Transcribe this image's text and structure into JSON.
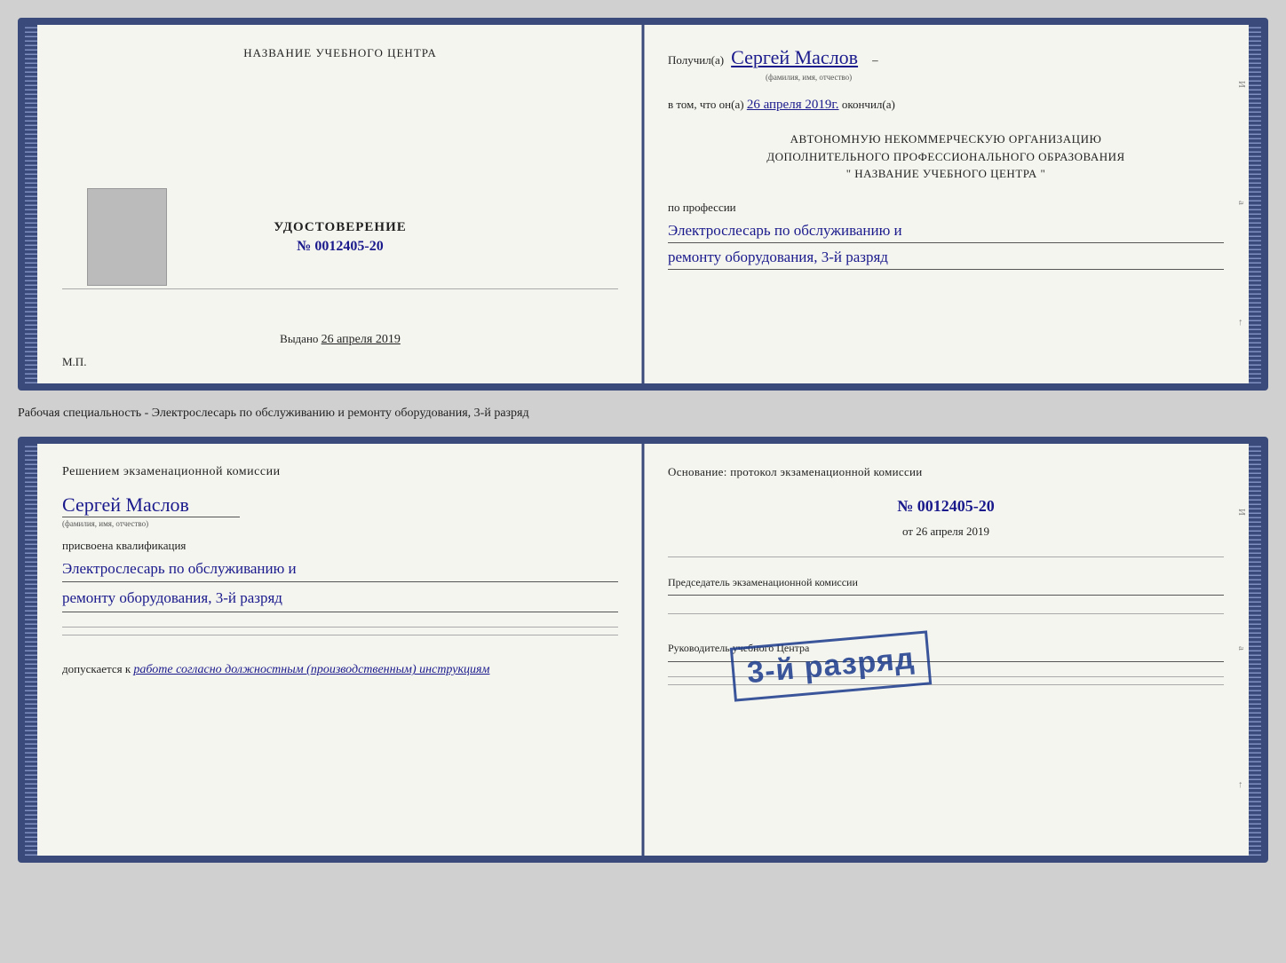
{
  "top_card": {
    "left": {
      "title": "НАЗВАНИЕ УЧЕБНОГО ЦЕНТРА",
      "udostoverenie": "УДОСТОВЕРЕНИЕ",
      "number_label": "№ 0012405-20",
      "vydano_label": "Выдано",
      "vydano_date": "26 апреля 2019",
      "mp_label": "М.П."
    },
    "right": {
      "poluchil_label": "Получил(а)",
      "recipient_name": "Сергей Маслов",
      "fio_label": "(фамилия, имя, отчество)",
      "vtom_label": "в том, что он(а)",
      "completion_date": "26 апреля 2019г.",
      "okončil_label": "окончил(а)",
      "org_line1": "АВТОНОМНУЮ НЕКОММЕРЧЕСКУЮ ОРГАНИЗАЦИЮ",
      "org_line2": "ДОПОЛНИТЕЛЬНОГО ПРОФЕССИОНАЛЬНОГО ОБРАЗОВАНИЯ",
      "org_line3": "\"   НАЗВАНИЕ УЧЕБНОГО ЦЕНТРА   \"",
      "po_professii_label": "по профессии",
      "profession_line1": "Электрослесарь по обслуживанию и",
      "profession_line2": "ремонту оборудования, 3-й разряд"
    }
  },
  "between_label": {
    "text": "Рабочая специальность - Электрослесарь по обслуживанию и ремонту оборудования, 3-й разряд"
  },
  "bottom_card": {
    "left": {
      "resheniem_label": "Решением экзаменационной комиссии",
      "name": "Сергей Маслов",
      "fio_label": "(фамилия, имя, отчество)",
      "prisvoena_label": "присвоена квалификация",
      "qualification_line1": "Электрослесарь по обслуживанию и",
      "qualification_line2": "ремонту оборудования, 3-й разряд",
      "dopuskaetsya_label": "допускается к",
      "dopusk_text": "работе согласно должностным (производственным) инструкциям"
    },
    "right": {
      "osnovanie_label": "Основание: протокол экзаменационной комиссии",
      "protocol_number": "№  0012405-20",
      "ot_label": "от",
      "ot_date": "26 апреля 2019",
      "predsedatel_label": "Председатель экзаменационной комиссии",
      "rukovoditel_label": "Руководитель учебного Центра"
    },
    "stamp": {
      "line1": "3-й разряд"
    }
  }
}
